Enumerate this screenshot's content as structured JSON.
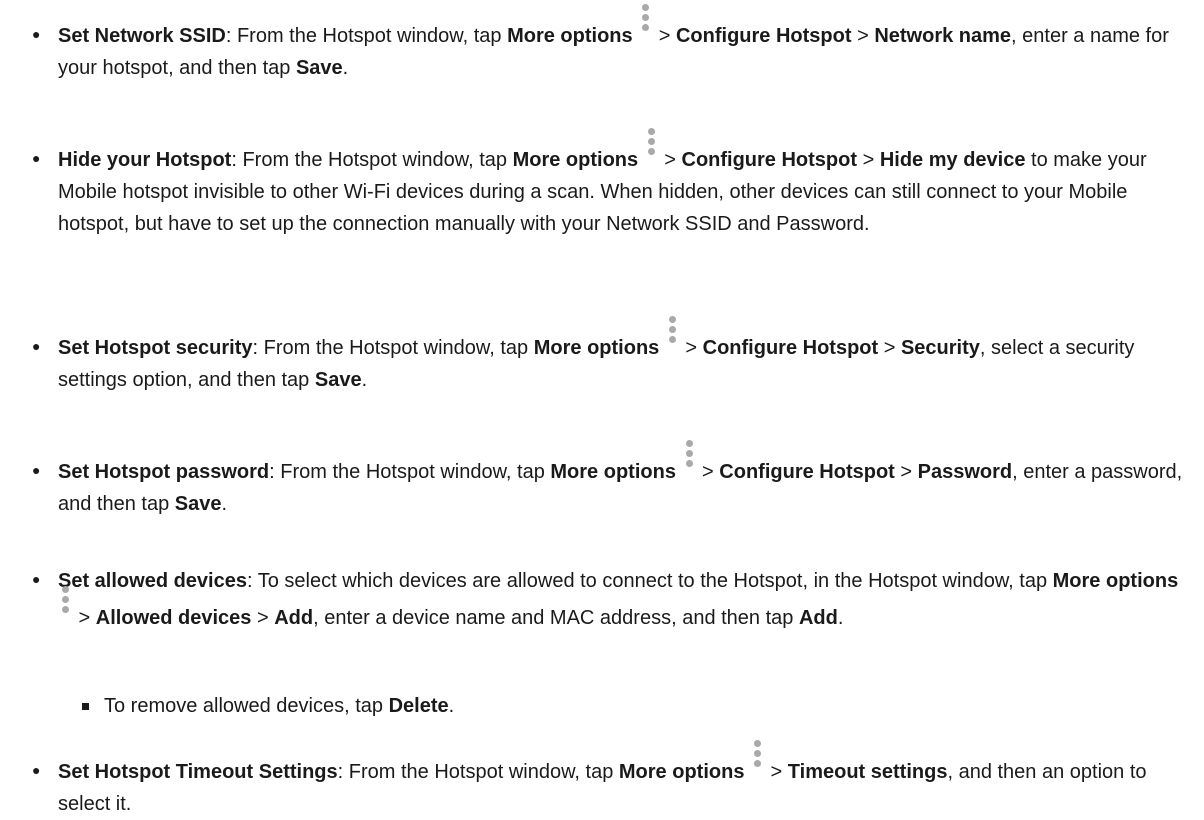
{
  "bullet_glyph": "●",
  "items": [
    {
      "title": "Set Network SSID",
      "intro": ": From the Hotspot window, tap ",
      "more_options": "More options",
      "sep1": " > ",
      "configure": "Configure Hotspot",
      "sep2": " > ",
      "option": "Network name",
      "rest": ", enter a name for your hotspot, and then tap ",
      "save": "Save",
      "end": "."
    },
    {
      "title": "Hide your Hotspot",
      "intro": ": From the Hotspot window, tap ",
      "more_options": "More options",
      "sep1": " > ",
      "configure": "Configure Hotspot",
      "sep2": " > ",
      "option": "Hide my device",
      "rest": " to make your Mobile hotspot invisible to other Wi-Fi devices during a scan. When hidden, other devices can still connect to your Mobile hotspot, but have to set up the connection manually with your Network SSID and Password."
    },
    {
      "title": "Set Hotspot security",
      "intro": ": From the Hotspot window, tap ",
      "more_options": "More options",
      "sep1": " > ",
      "configure": "Configure Hotspot",
      "sep2": " > ",
      "option": "Security",
      "rest": ", select a security settings option, and then tap ",
      "save": "Save",
      "end": "."
    },
    {
      "title": "Set Hotspot password",
      "intro": ": From the Hotspot window, tap ",
      "more_options": "More options",
      "sep1": " > ",
      "configure": "Configure Hotspot",
      "sep2": " > ",
      "option": "Password",
      "rest": ", enter a password, and then tap ",
      "save": "Save",
      "end": "."
    },
    {
      "title": "Set allowed devices",
      "intro": ": To select which devices are allowed to connect to the Hotspot, in the Hotspot window, tap ",
      "more_options": "More options",
      "sep1": " > ",
      "allowed": "Allowed devices",
      "sep2": " > ",
      "add1": "Add",
      "rest": ", enter a device name and MAC address, and then tap ",
      "add2": "Add",
      "end": "."
    },
    {
      "title": "Set Hotspot Timeout Settings",
      "intro": ": From the Hotspot window, tap ",
      "more_options": "More options",
      "sep1": " > ",
      "timeout": "Timeout settings",
      "rest": ", and then an option to select it."
    }
  ],
  "sub_item": {
    "intro": "To remove allowed devices, tap ",
    "delete": "Delete",
    "end": "."
  }
}
